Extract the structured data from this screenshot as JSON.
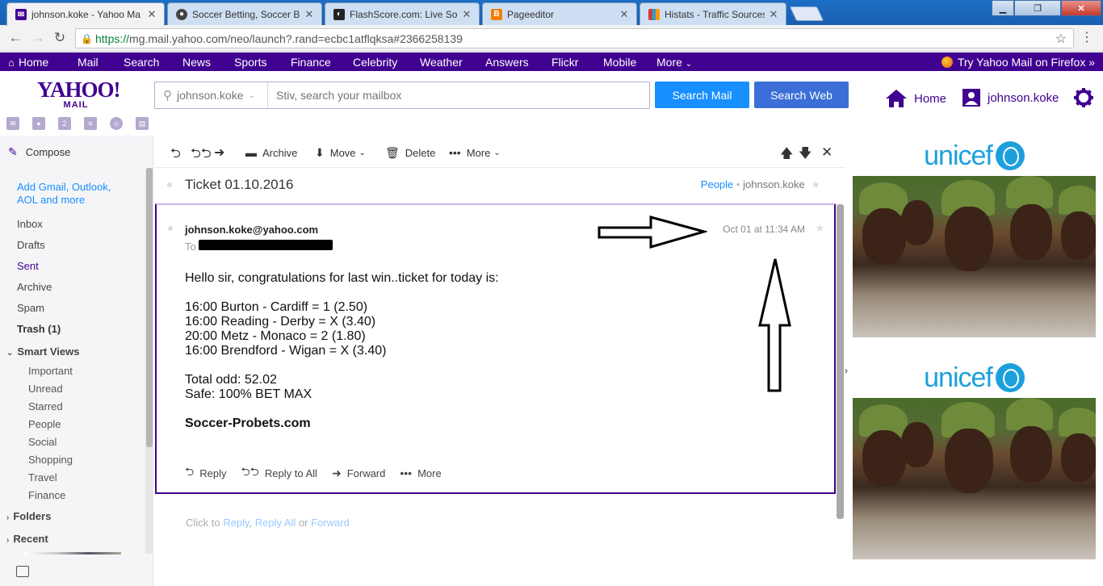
{
  "browser": {
    "tabs": [
      {
        "title": "johnson.koke - Yahoo Ma",
        "active": true,
        "icon": "yahoo-mail-icon"
      },
      {
        "title": "Soccer Betting, Soccer Be",
        "active": false,
        "icon": "soccer-ball-icon"
      },
      {
        "title": "FlashScore.com: Live Soc",
        "active": false,
        "icon": "flashscore-icon"
      },
      {
        "title": "Pageeditor",
        "active": false,
        "icon": "blogger-icon"
      },
      {
        "title": "Histats - Traffic Sources f",
        "active": false,
        "icon": "histats-icon"
      }
    ],
    "url_secure": "https://",
    "url_rest": "mg.mail.yahoo.com/neo/launch?.rand=ecbc1atflqksa#2366258139"
  },
  "yahoo_nav": {
    "items": [
      "Home",
      "Mail",
      "Search",
      "News",
      "Sports",
      "Finance",
      "Celebrity",
      "Weather",
      "Answers",
      "Flickr",
      "Mobile",
      "More"
    ],
    "promo": "Try Yahoo Mail on Firefox »"
  },
  "header": {
    "logo_top": "YAHOO!",
    "logo_bottom": "MAIL",
    "search_account": "johnson.koke",
    "search_placeholder": "Stiv, search your mailbox",
    "search_mail_label": "Search Mail",
    "search_web_label": "Search Web",
    "home_label": "Home",
    "user_label": "johnson.koke",
    "colors": {
      "brand": "#400090",
      "search_mail": "#188fff",
      "search_web": "#3b6fd7"
    }
  },
  "sidebar": {
    "compose": "Compose",
    "add_accounts": "Add Gmail, Outlook, AOL and more",
    "folders": [
      "Inbox",
      "Drafts",
      "Sent",
      "Archive",
      "Spam",
      "Trash (1)"
    ],
    "smart_views_label": "Smart Views",
    "smart_views": [
      "Important",
      "Unread",
      "Starred",
      "People",
      "Social",
      "Shopping",
      "Travel",
      "Finance"
    ],
    "folders_label": "Folders",
    "recent_label": "Recent"
  },
  "toolbar": {
    "archive": "Archive",
    "move": "Move",
    "delete": "Delete",
    "more": "More"
  },
  "conversation": {
    "subject": "Ticket 01.10.2016",
    "people_label": "People",
    "people_user": "johnson.koke"
  },
  "message": {
    "from": "johnson.koke@yahoo.com",
    "to_label": "To",
    "date": "Oct 01 at 11:34 AM",
    "greeting": "Hello sir, congratulations for last win..ticket for today is:",
    "tips": [
      "16:00 Burton - Cardiff = 1 (2.50)",
      "16:00 Reading - Derby = X (3.40)",
      "20:00 Metz - Monaco = 2 (1.80)",
      "16:00 Brendford - Wigan = X (3.40)"
    ],
    "total_odd": "Total odd: 52.02",
    "safe": "Safe: 100% BET MAX",
    "signature": "Soccer-Probets.com",
    "actions": {
      "reply": "Reply",
      "reply_all": "Reply to All",
      "forward": "Forward",
      "more": "More"
    }
  },
  "quick_reply": {
    "prefix": "Click to ",
    "reply": "Reply",
    "sep1": ", ",
    "reply_all": "Reply All",
    "sep2": " or ",
    "forward": "Forward"
  },
  "ads": [
    {
      "brand": "unicef"
    },
    {
      "brand": "unicef"
    }
  ]
}
